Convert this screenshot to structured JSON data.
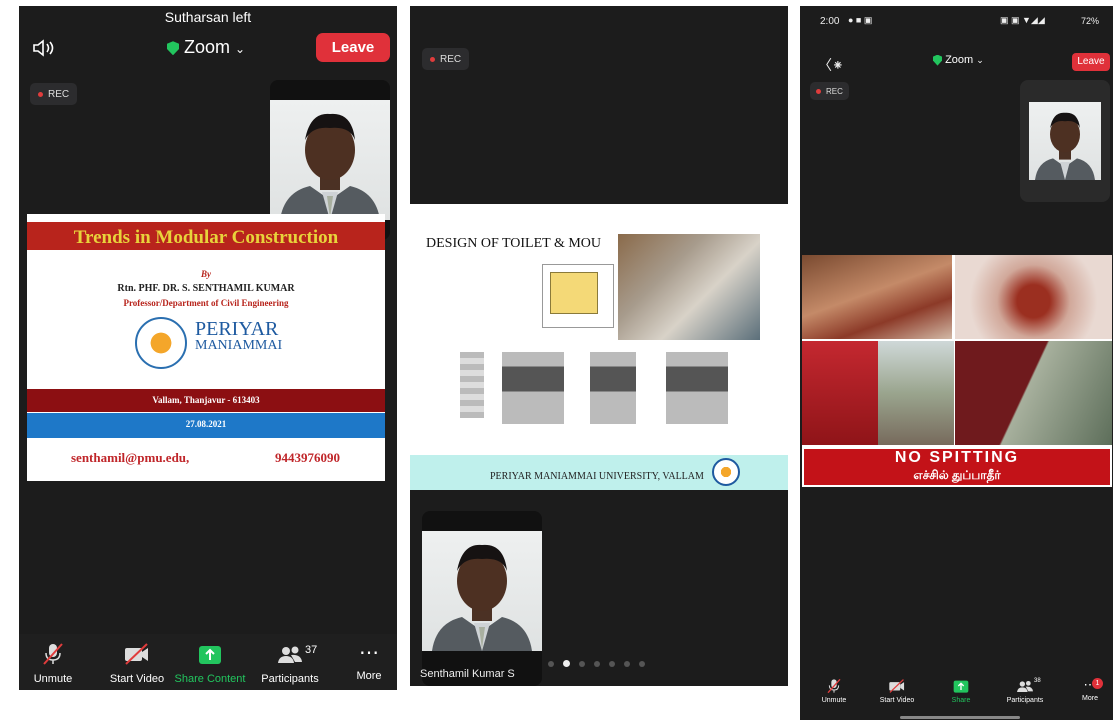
{
  "phone1": {
    "notice": "Sutharsan left",
    "meeting_title": "Zoom",
    "leave_label": "Leave",
    "rec_label": "REC",
    "slide": {
      "title": "Trends in Modular Construction",
      "by": "By",
      "author": "Rtn. PHF. DR. S. SENTHAMIL KUMAR",
      "dept": "Professor/Department of Civil Engineering",
      "logo_line1": "PERIYAR",
      "logo_line2": "MANIAMMAI",
      "location": "Vallam, Thanjavur - 613403",
      "date": "27.08.2021",
      "email": "senthamil@pmu.edu,",
      "phone": "9443976090"
    },
    "toolbar": {
      "unmute": "Unmute",
      "start_video": "Start Video",
      "share": "Share Content",
      "participants": "Participants",
      "participants_count": "37",
      "more": "More"
    }
  },
  "phone2": {
    "rec_label": "REC",
    "slide": {
      "title": "DESIGN OF TOILET & MOU",
      "footer": "PERIYAR MANIAMMAI UNIVERSITY, VALLAM"
    },
    "speaker_name": "Senthamil Kumar S",
    "pages": 7,
    "active_page": 1
  },
  "phone3": {
    "status_time": "2:00",
    "status_battery": "72%",
    "meeting_title": "Zoom",
    "leave_label": "Leave",
    "rec_label": "REC",
    "sign_line1": "NO SPITTING",
    "sign_line2": "எச்சில் துப்பாதீர்",
    "toolbar": {
      "unmute": "Unmute",
      "start_video": "Start Video",
      "share": "Share",
      "participants": "Participants",
      "participants_count": "38",
      "more": "More",
      "more_badge": "1"
    }
  }
}
